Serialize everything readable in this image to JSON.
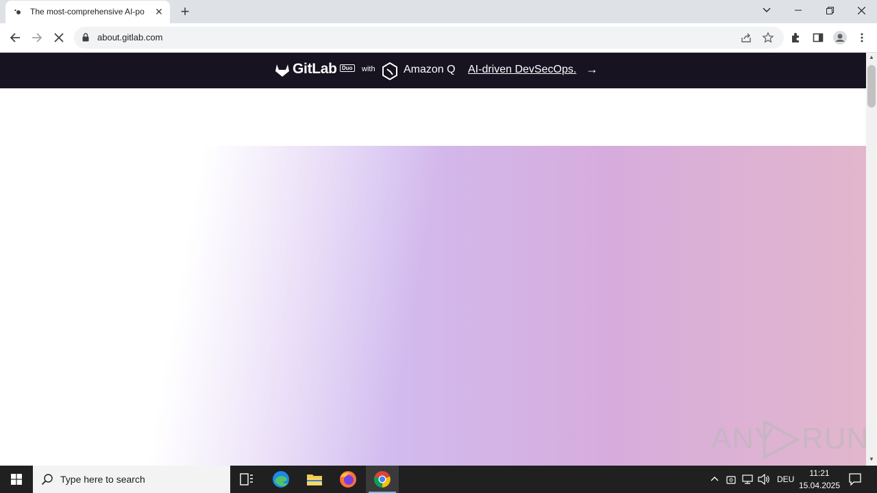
{
  "browser": {
    "tab_title": "The most-comprehensive AI-po",
    "url": "about.gitlab.com"
  },
  "banner": {
    "brand": "GitLab",
    "badge": "Duo",
    "with": "with",
    "partner": "Amazon Q",
    "link": "AI-driven DevSecOps.",
    "arrow": "→"
  },
  "watermark": {
    "left": "ANY",
    "right": "RUN"
  },
  "taskbar": {
    "search_placeholder": "Type here to search",
    "language": "DEU",
    "time": "11:21",
    "date": "15.04.2025"
  },
  "colors": {
    "banner_bg": "#171321",
    "taskbar_bg": "#202020",
    "tabstrip_bg": "#dee1e6"
  }
}
